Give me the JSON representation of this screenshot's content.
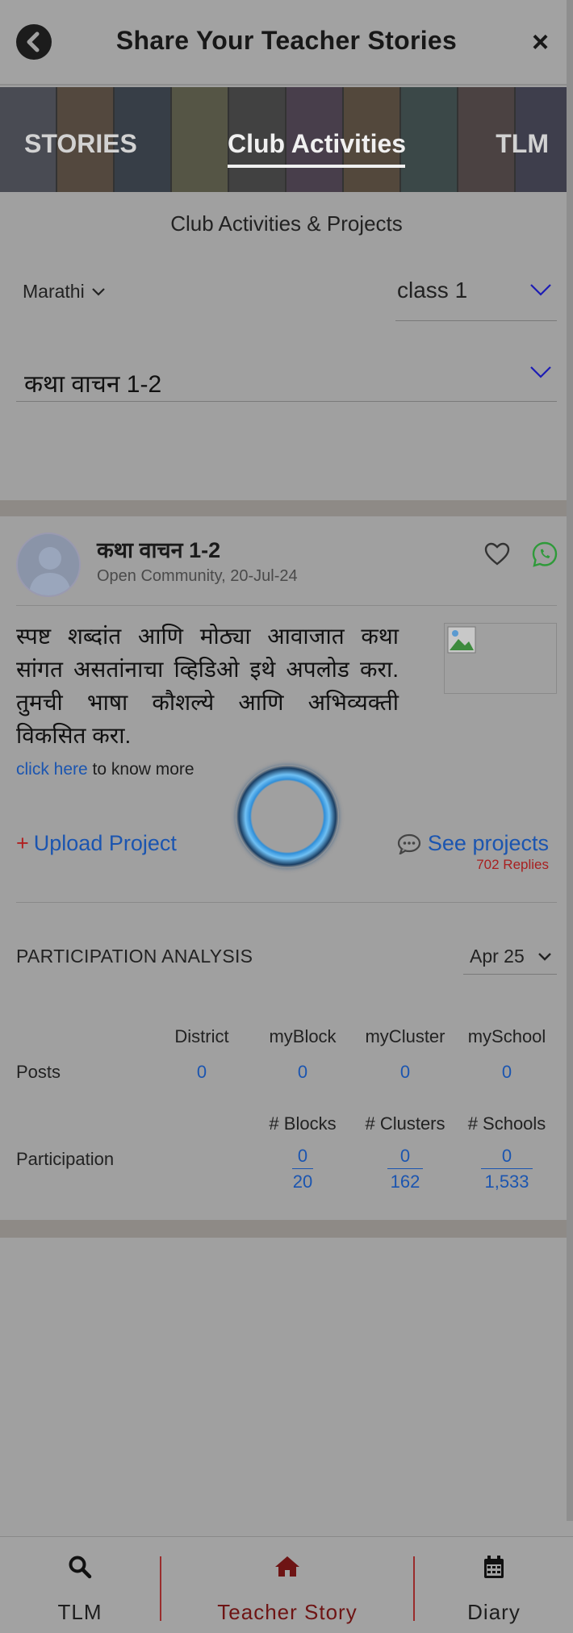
{
  "header": {
    "title": "Share Your Teacher Stories",
    "close_label": "×"
  },
  "tabs": [
    {
      "label": "STORIES"
    },
    {
      "label": "Club Activities",
      "active": true
    },
    {
      "label": "TLM"
    }
  ],
  "filters": {
    "section_title": "Club Activities & Projects",
    "language": "Marathi",
    "class": "class 1",
    "activity": "कथा वाचन 1-2"
  },
  "post": {
    "title": "कथा वाचन 1-2",
    "meta": "Open Community, 20-Jul-24",
    "description": "स्पष्ट शब्दांत आणि मोठ्या आवाजात कथा सांगत असतांनाचा व्हिडिओ इथे अपलोड करा. तुमची भाषा कौशल्ये आणि अभिव्यक्ती विकसित करा.",
    "more_link": "click here",
    "more_suffix": " to know more",
    "upload_label": "Upload Project",
    "see_label": "See projects",
    "replies": "702 Replies"
  },
  "analysis": {
    "title": "PARTICIPATION ANALYSIS",
    "month": "Apr 25",
    "posts_headers": [
      "District",
      "myBlock",
      "myCluster",
      "mySchool"
    ],
    "posts_label": "Posts",
    "posts_values": [
      "0",
      "0",
      "0",
      "0"
    ],
    "participation_headers": [
      "# Blocks",
      "# Clusters",
      "# Schools"
    ],
    "participation_label": "Participation",
    "participation_numerators": [
      "0",
      "0",
      "0"
    ],
    "participation_denominators": [
      "20",
      "162",
      "1,533"
    ]
  },
  "bottom_nav": [
    {
      "label": "TLM",
      "icon": "search-icon"
    },
    {
      "label": "Teacher Story",
      "icon": "home-icon",
      "active": true
    },
    {
      "label": "Diary",
      "icon": "calendar-icon"
    }
  ],
  "colors": {
    "link_blue": "#1b55b0",
    "replies_red": "#a82020",
    "active_nav": "#6e1414",
    "whatsapp_green": "#2f9a3a"
  }
}
